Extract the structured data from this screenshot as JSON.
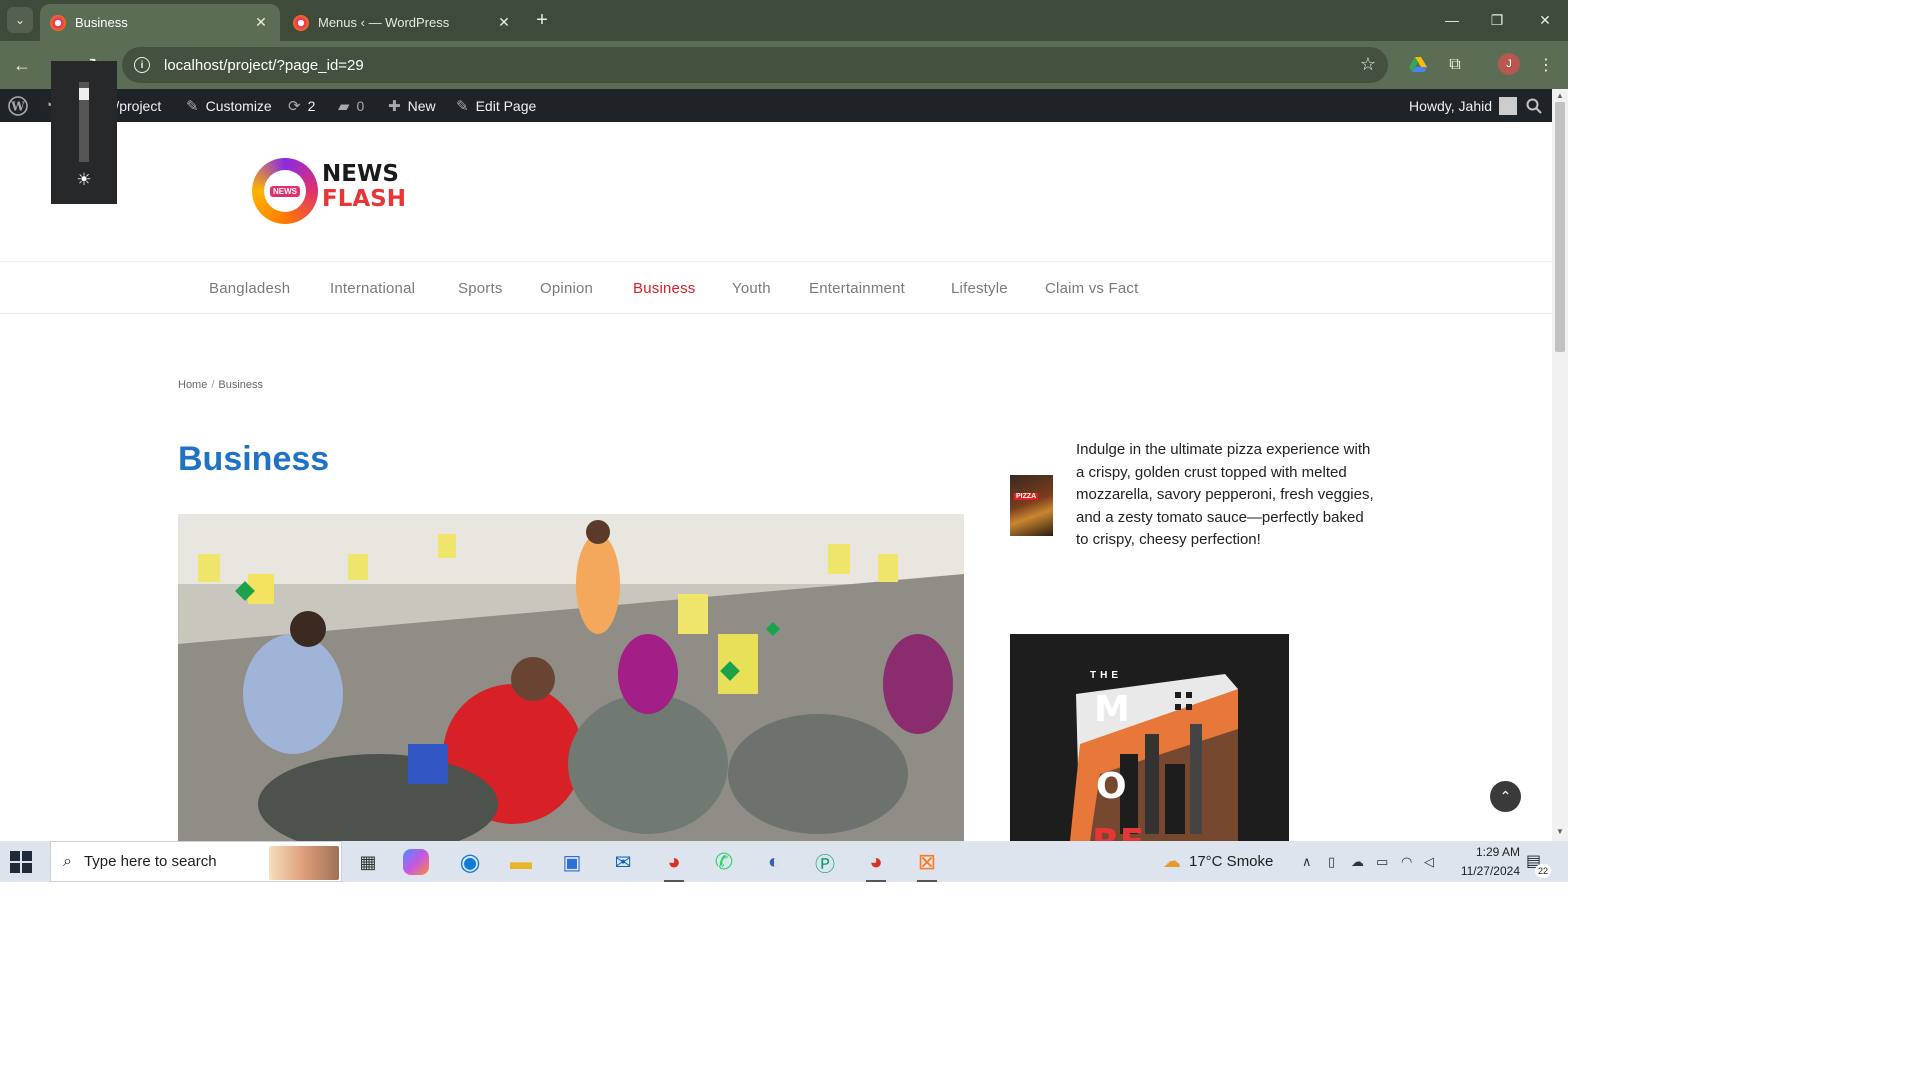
{
  "browser": {
    "tabs": [
      {
        "title": "Business",
        "active": true
      },
      {
        "title": "Menus ‹ — WordPress",
        "active": false
      }
    ],
    "url": "localhost/project/?page_id=29",
    "profile_initial": "J"
  },
  "admin_bar": {
    "site_name": "localhost/project",
    "customize": "Customize",
    "updates_count": "2",
    "comments_count": "0",
    "new_label": "New",
    "edit_label": "Edit Page",
    "howdy": "Howdy, Jahid"
  },
  "site": {
    "logo_line1": "NEWS",
    "logo_line2": "FLASH",
    "logo_badge": "NEWS",
    "nav": [
      {
        "label": "Bangladesh",
        "active": false
      },
      {
        "label": "International",
        "active": false
      },
      {
        "label": "Sports",
        "active": false
      },
      {
        "label": "Opinion",
        "active": false
      },
      {
        "label": "Business",
        "active": true
      },
      {
        "label": "Youth",
        "active": false
      },
      {
        "label": "Entertainment",
        "active": false
      },
      {
        "label": "Lifestyle",
        "active": false
      },
      {
        "label": "Claim vs Fact",
        "active": false
      }
    ],
    "accent_color": "#d61f26",
    "title_color": "#1f73c5"
  },
  "breadcrumb": {
    "home": "Home",
    "separator": "/",
    "current": "Business"
  },
  "page_title": "Business",
  "sidebar": {
    "pizza_tag": "PIZZA",
    "pizza_text": "Indulge in the ultimate pizza experience with a crispy, golden crust topped with melted mozzarella, savory pepperoni, fresh veggies, and a zesty tomato sauce—perfectly baked to crispy, cheesy perfection!",
    "poster_top": "THE",
    "poster_letters": [
      "M",
      "O",
      "RE"
    ]
  },
  "taskbar": {
    "search_placeholder": "Type here to search",
    "weather": "17°C  Smoke",
    "time": "1:29 AM",
    "date": "11/27/2024",
    "notification_count": "22"
  }
}
